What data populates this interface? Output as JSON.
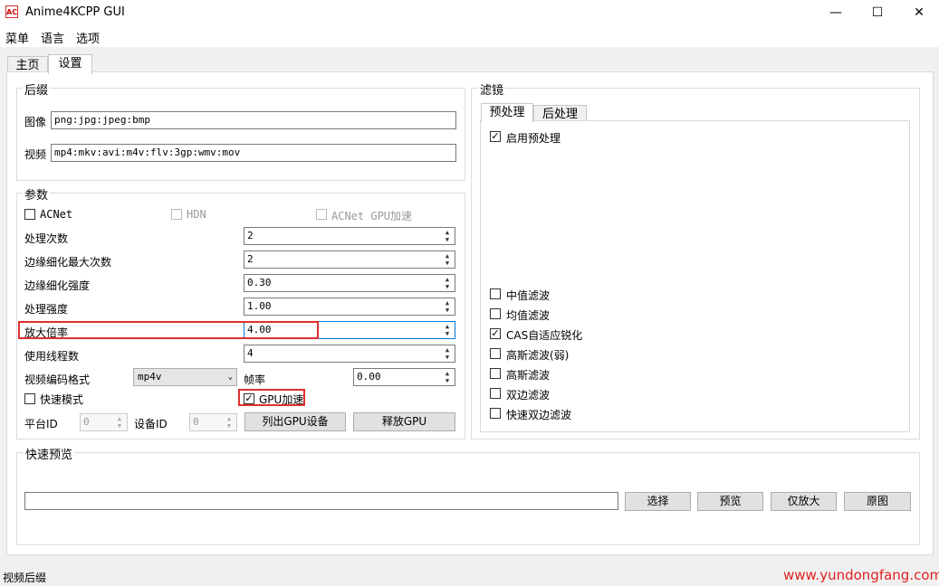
{
  "window": {
    "title": "Anime4KCPP GUI",
    "icon_text": "AC",
    "minimize_glyph": "—",
    "maximize_glyph": "☐",
    "close_glyph": "✕"
  },
  "menubar": {
    "items": [
      "菜单",
      "语言",
      "选项"
    ]
  },
  "tabs": [
    "主页",
    "设置"
  ],
  "suffix": {
    "title": "后缀",
    "image_label": "图像",
    "image_value": "png:jpg:jpeg:bmp",
    "video_label": "视频",
    "video_value": "mp4:mkv:avi:m4v:flv:3gp:wmv:mov"
  },
  "params": {
    "title": "参数",
    "acnet_label": "ACNet",
    "hdn_label": "HDN",
    "acnet_gpu_label": "ACNet GPU加速",
    "rows": [
      {
        "label": "处理次数",
        "value": "2"
      },
      {
        "label": "边缘细化最大次数",
        "value": "2"
      },
      {
        "label": "边缘细化强度",
        "value": "0.30"
      },
      {
        "label": "处理强度",
        "value": "1.00"
      },
      {
        "label": "放大倍率",
        "value": "4.00"
      },
      {
        "label": "使用线程数",
        "value": "4"
      }
    ],
    "codec_label": "视频编码格式",
    "codec_value": "mp4v",
    "fps_label": "帧率",
    "fps_value": "0.00",
    "fast_mode_label": "快速模式",
    "gpu_label": "GPU加速",
    "gpu_checked": true,
    "platform_label": "平台ID",
    "platform_value": "0",
    "device_label": "设备ID",
    "device_value": "0",
    "list_gpu_button": "列出GPU设备",
    "release_gpu_button": "释放GPU"
  },
  "filters": {
    "title": "滤镜",
    "tabs": [
      "预处理",
      "后处理"
    ],
    "enable_pre_label": "启用预处理",
    "enable_pre_checked": true,
    "items": [
      {
        "label": "中值滤波",
        "checked": false
      },
      {
        "label": "均值滤波",
        "checked": false
      },
      {
        "label": "CAS自适应锐化",
        "checked": true
      },
      {
        "label": "高斯滤波(弱)",
        "checked": false
      },
      {
        "label": "高斯滤波",
        "checked": false
      },
      {
        "label": "双边滤波",
        "checked": false
      },
      {
        "label": "快速双边滤波",
        "checked": false
      }
    ]
  },
  "preview": {
    "title": "快速预览",
    "path_value": "",
    "buttons": [
      "选择",
      "预览",
      "仅放大",
      "原图"
    ]
  },
  "status": {
    "text": "视频后缀"
  },
  "watermark": {
    "text": "www.yundongfang.com",
    "color": "#e02020"
  },
  "colors": {
    "highlight": "#e03030",
    "accent": "#0078d7"
  }
}
